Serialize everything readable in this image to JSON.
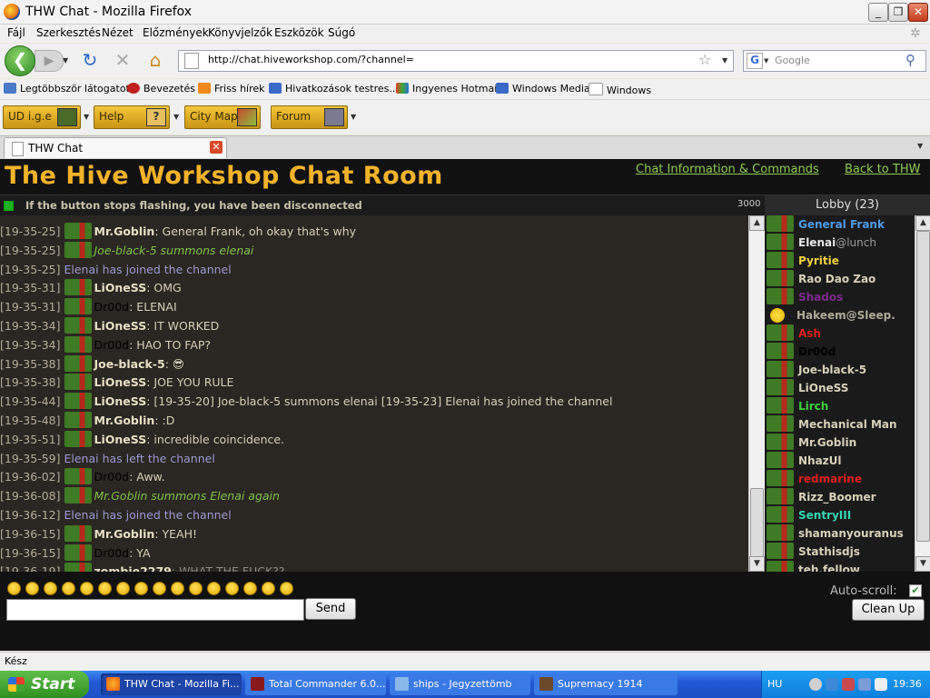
{
  "window": {
    "title": "THW Chat - Mozilla Firefox"
  },
  "menu": [
    "Fájl",
    "Szerkesztés",
    "Nézet",
    "Előzmények",
    "Könyvjelzők",
    "Eszközök",
    "Súgó"
  ],
  "nav": {
    "url": "http://chat.hiveworkshop.com/?channel=",
    "search_placeholder": "Google"
  },
  "bookmarks": [
    "Legtöbbször látogatott",
    "Bevezetés",
    "Friss hírek",
    "Hivatkozások testres...",
    "Ingyenes Hotmail",
    "Windows Media",
    "Windows"
  ],
  "toolbar2": [
    "UD i.g.e",
    "Help",
    "City Map",
    "Forum"
  ],
  "tab": {
    "title": "THW Chat"
  },
  "page": {
    "title": "The Hive Workshop Chat Room",
    "links": [
      "Chat Information & Commands",
      "Back to THW"
    ],
    "status_message": "If the button stops flashing, you have been disconnected",
    "char_limit": "3000",
    "lobby_header": "Lobby (23)"
  },
  "chat": [
    {
      "ts": "[19-35-25]",
      "type": "msg",
      "name": "Mr.Goblin",
      "text": ": General Frank, oh okay that's why"
    },
    {
      "ts": "[19-35-25]",
      "type": "action",
      "text": "Joe-black-5 summons elenai"
    },
    {
      "ts": "[19-35-25]",
      "type": "system",
      "text": "Elenai has joined the channel"
    },
    {
      "ts": "[19-35-31]",
      "type": "msg",
      "name": "LiOneSS",
      "text": ": OMG"
    },
    {
      "ts": "[19-35-31]",
      "type": "msgdark",
      "name": "Dr00d",
      "text": ": ELENAI"
    },
    {
      "ts": "[19-35-34]",
      "type": "msg",
      "name": "LiOneSS",
      "text": ": IT WORKED"
    },
    {
      "ts": "[19-35-34]",
      "type": "msgdark",
      "name": "Dr00d",
      "text": ": HAO TO FAP?"
    },
    {
      "ts": "[19-35-38]",
      "type": "msg",
      "name": "Joe-black-5",
      "text": ": 😎"
    },
    {
      "ts": "[19-35-38]",
      "type": "msg",
      "name": "LiOneSS",
      "text": ": JOE YOU RULE"
    },
    {
      "ts": "[19-35-44]",
      "type": "msg",
      "name": "LiOneSS",
      "text": ": [19-35-20] Joe-black-5 summons elenai [19-35-23] Elenai has joined the channel"
    },
    {
      "ts": "[19-35-48]",
      "type": "msg",
      "name": "Mr.Goblin",
      "text": ": :D"
    },
    {
      "ts": "[19-35-51]",
      "type": "msg",
      "name": "LiOneSS",
      "text": ": incredible coincidence."
    },
    {
      "ts": "[19-35-59]",
      "type": "system",
      "text": "Elenai has left the channel"
    },
    {
      "ts": "[19-36-02]",
      "type": "msgdark",
      "name": "Dr00d",
      "text": ": Aww."
    },
    {
      "ts": "[19-36-08]",
      "type": "action",
      "text": "Mr.Goblin summons Elenai again"
    },
    {
      "ts": "[19-36-12]",
      "type": "system",
      "text": "Elenai has joined the channel"
    },
    {
      "ts": "[19-36-15]",
      "type": "msg",
      "name": "Mr.Goblin",
      "text": ": YEAH!"
    },
    {
      "ts": "[19-36-15]",
      "type": "msgdark",
      "name": "Dr00d",
      "text": ": YA"
    },
    {
      "ts": "[19-36-19]",
      "type": "msggrey",
      "name": "zombie2279",
      "text": ": WHAT THE FUCK??"
    }
  ],
  "lobby": [
    {
      "name": "General Frank",
      "color": "#4e9be8"
    },
    {
      "name": "Elenai",
      "suffix": "@lunch",
      "color": "#e8e8e8"
    },
    {
      "name": "Pyritie",
      "color": "#f0d040"
    },
    {
      "name": "Rao Dao Zao",
      "color": "#d8d0b8"
    },
    {
      "name": "Shados",
      "color": "#7a2a8a"
    },
    {
      "name": "Hakeem@Sleep.",
      "color": "#b0aa98",
      "smile": true
    },
    {
      "name": "Ash",
      "color": "#d82020"
    },
    {
      "name": "Dr00d",
      "color": "#000000"
    },
    {
      "name": "Joe-black-5",
      "color": "#d8d0b8"
    },
    {
      "name": "LiOneSS",
      "color": "#d8d0b8"
    },
    {
      "name": "Lirch",
      "color": "#3ed03e"
    },
    {
      "name": "Mechanical Man",
      "color": "#d8d0b8"
    },
    {
      "name": "Mr.Goblin",
      "color": "#d8d0b8"
    },
    {
      "name": "NhazUl",
      "color": "#d8d0b8"
    },
    {
      "name": "redmarine",
      "color": "#d82020"
    },
    {
      "name": "Rizz_Boomer",
      "color": "#d8d0b8"
    },
    {
      "name": "SentryIII",
      "color": "#34d6b4"
    },
    {
      "name": "shamanyouranus",
      "color": "#d8d0b8"
    },
    {
      "name": "Stathisdjs",
      "color": "#d8d0b8"
    },
    {
      "name": "teh.fellow",
      "color": "#d8d0b8"
    }
  ],
  "bottom": {
    "send_label": "Send",
    "autoscroll_label": "Auto-scroll:",
    "clean_label": "Clean Up",
    "autoscroll_mark": "✔"
  },
  "statusbar": {
    "text": "Kész"
  },
  "taskbar": {
    "start": "Start",
    "tasks": [
      "THW Chat - Mozilla Fi...",
      "Total Commander 6.0...",
      "ships - Jegyzettömb",
      "Supremacy 1914"
    ],
    "lang": "HU",
    "clock": "19:36"
  }
}
